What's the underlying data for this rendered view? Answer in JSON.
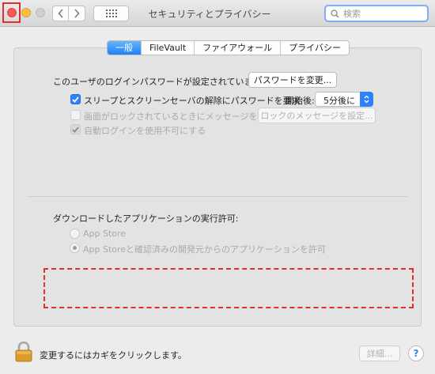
{
  "window": {
    "title": "セキュリティとプライバシー"
  },
  "search": {
    "placeholder": "検索"
  },
  "tabs": [
    {
      "label": "一般",
      "active": true
    },
    {
      "label": "FileVault",
      "active": false
    },
    {
      "label": "ファイアウォール",
      "active": false
    },
    {
      "label": "プライバシー",
      "active": false
    }
  ],
  "general": {
    "password_label": "このユーザのログインパスワードが設定されています",
    "change_password_button": "パスワードを変更...",
    "require_password": {
      "label": "スリープとスクリーンセーバの解除にパスワードを要求",
      "checked": true
    },
    "start_label": "開始後:",
    "start_value": "5分後に",
    "show_message": {
      "label": "画面がロックされているときにメッセージを表示",
      "checked": false,
      "enabled": false
    },
    "set_lock_message_button": "ロックのメッセージを設定...",
    "disable_auto_login": {
      "label": "自動ログインを使用不可にする",
      "checked": true,
      "enabled": false
    }
  },
  "downloads": {
    "heading": "ダウンロードしたアプリケーションの実行許可:",
    "options": [
      {
        "label": "App Store",
        "selected": false
      },
      {
        "label": "App Storeと確認済みの開発元からのアプリケーションを許可",
        "selected": true
      }
    ]
  },
  "footer": {
    "lock_text": "変更するにはカギをクリックします。",
    "advanced_button": "詳細...",
    "help_label": "?"
  },
  "colors": {
    "accent": "#2d82f9",
    "highlight": "#e0302b"
  }
}
